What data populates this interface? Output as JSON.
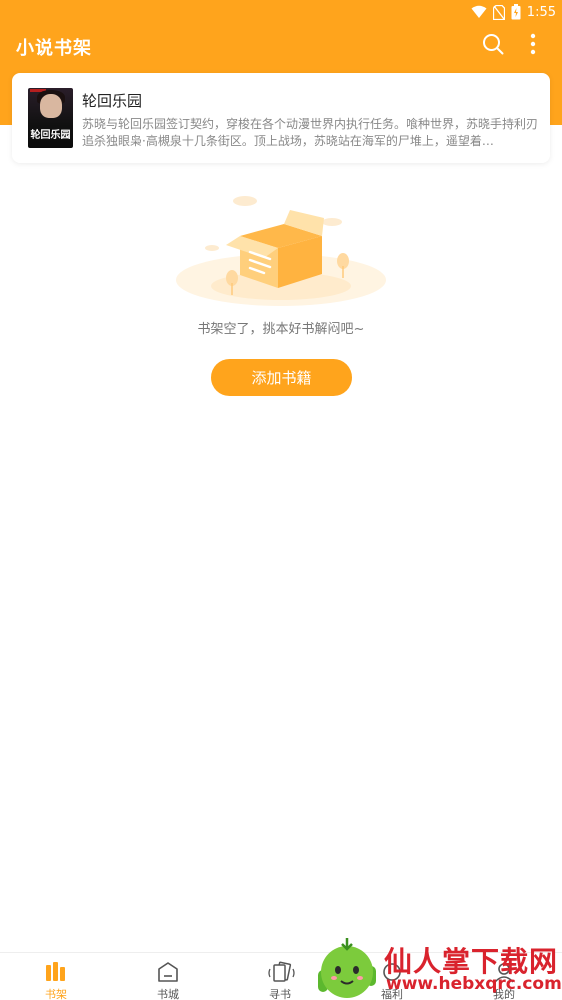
{
  "status_bar": {
    "time": "1:55",
    "icons": [
      "wifi-icon",
      "no-sim-icon",
      "battery-icon"
    ]
  },
  "header": {
    "title": "小说书架",
    "actions": [
      "search-icon",
      "more-vert-icon"
    ]
  },
  "bookshelf": {
    "books": [
      {
        "title": "轮回乐园",
        "cover_title": "轮回乐园",
        "description": "苏晓与轮回乐园签订契约，穿梭在各个动漫世界内执行任务。喰种世界，苏晓手持利刃追杀独眼枭·高槻泉十几条街区。顶上战场，苏晓站在海军的尸堆上，遥望着…"
      }
    ]
  },
  "empty_state": {
    "message": "书架空了，挑本好书解闷吧~",
    "button_label": "添加书籍"
  },
  "bottom_nav": {
    "items": [
      {
        "label": "书架",
        "icon": "bookshelf-icon",
        "active": true
      },
      {
        "label": "书城",
        "icon": "store-icon",
        "active": false
      },
      {
        "label": "寻书",
        "icon": "find-book-icon",
        "active": false
      },
      {
        "label": "福利",
        "icon": "gift-icon",
        "active": false
      },
      {
        "label": "我的",
        "icon": "profile-icon",
        "active": false
      }
    ]
  },
  "watermark": {
    "text": "仙人掌下载网",
    "url": "www.hebxqrc.com"
  },
  "colors": {
    "accent": "#FFA41C",
    "watermark": "#d9232d"
  }
}
